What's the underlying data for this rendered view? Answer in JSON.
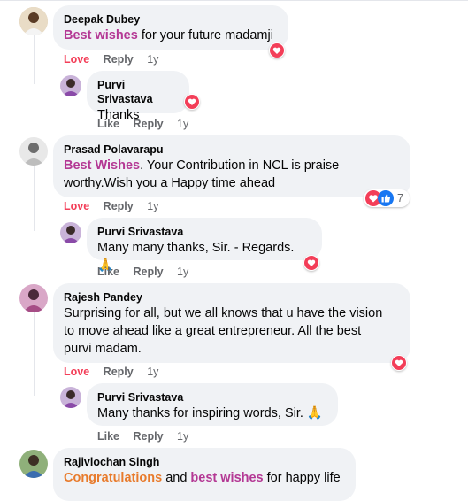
{
  "comments": [
    {
      "author": "Deepak Dubey",
      "text_highlight": "Best wishes",
      "text_rest": " for your future madamji",
      "actions": {
        "love": "Love",
        "reply": "Reply",
        "time": "1y"
      },
      "reply": {
        "author": "Purvi Srivastava",
        "text": "Thanks",
        "actions": {
          "like": "Like",
          "reply": "Reply",
          "time": "1y"
        }
      }
    },
    {
      "author": "Prasad Polavarapu",
      "text_highlight": "Best Wishes",
      "text_rest_1": ". Your Contribution in NCL is praise",
      "text_line2": "worthy.Wish you a Happy time ahead",
      "reaction_count": "7",
      "actions": {
        "love": "Love",
        "reply": "Reply",
        "time": "1y"
      },
      "reply": {
        "author": "Purvi Srivastava",
        "text": "Many many thanks, Sir. - Regards. 🙏",
        "actions": {
          "like": "Like",
          "reply": "Reply",
          "time": "1y"
        }
      }
    },
    {
      "author": "Rajesh Pandey",
      "line1": "Surprising for all, but we all knows that u have the vision",
      "line2": "to move ahead like a great entrepreneur. All the best",
      "line3": "purvi madam.",
      "actions": {
        "love": "Love",
        "reply": "Reply",
        "time": "1y"
      },
      "reply": {
        "author": "Purvi Srivastava",
        "text": "Many thanks for inspiring words, Sir. 🙏",
        "actions": {
          "like": "Like",
          "reply": "Reply",
          "time": "1y"
        }
      }
    },
    {
      "author": "Rajivlochan Singh",
      "hl1": "Congratulations",
      "mid": " and ",
      "hl2": "best wishes",
      "rest": " for happy life"
    }
  ],
  "colors": {
    "love": "#f33e58",
    "like_blue": "#1877f2",
    "highlight": "#b43894"
  }
}
